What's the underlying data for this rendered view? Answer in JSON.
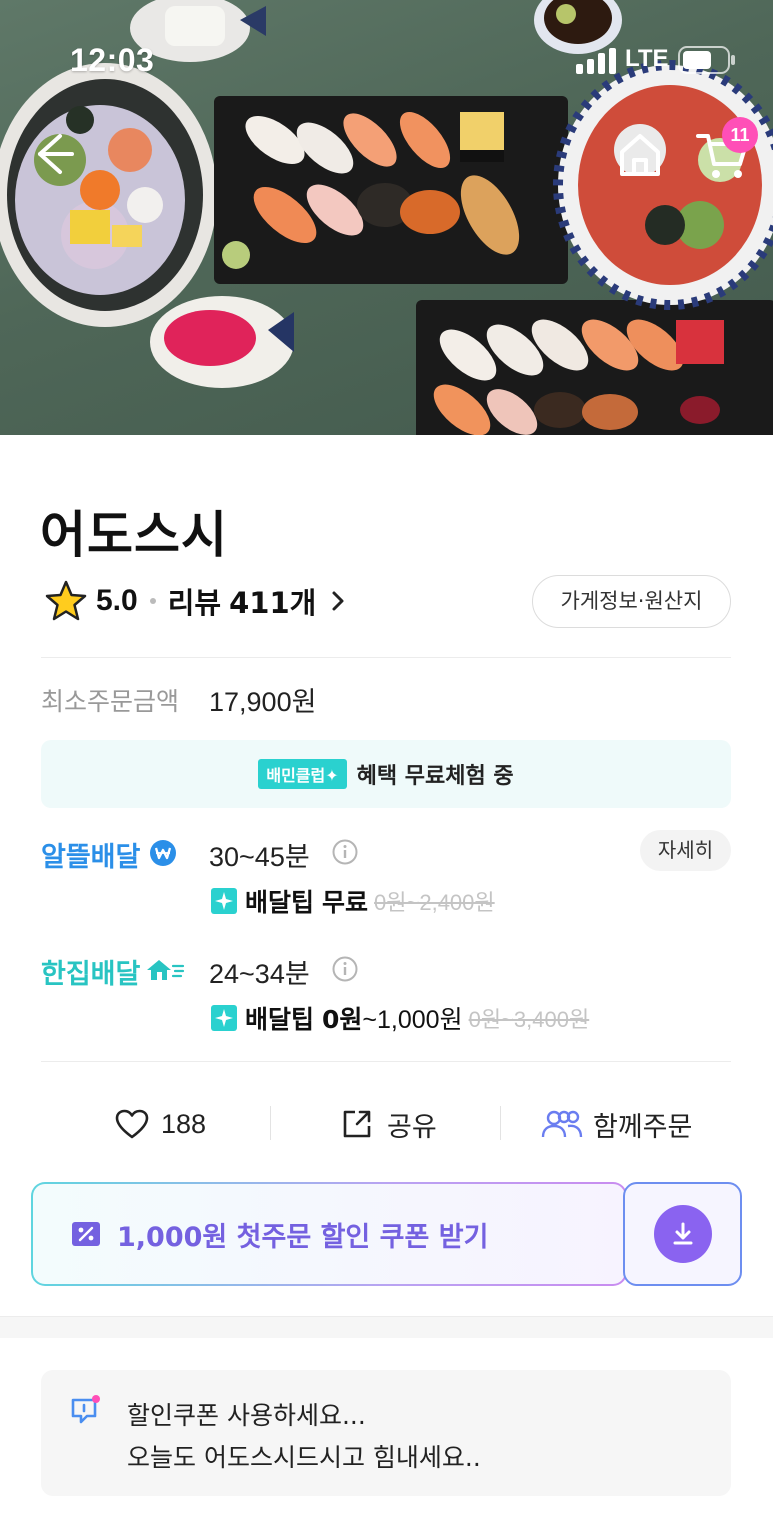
{
  "status_bar": {
    "time": "12:03",
    "network": "LTE"
  },
  "header": {
    "cart_count": "11"
  },
  "store": {
    "name": "어도스시",
    "rating": "5.0",
    "review_label": "리뷰",
    "review_count": "411개",
    "info_button": "가게정보·원산지"
  },
  "min_order": {
    "label": "최소주문금액",
    "value": "17,900원"
  },
  "club": {
    "tag": "배민클럽✦",
    "text": "혜택 무료체험 중"
  },
  "delivery_options": [
    {
      "name": "알뜰배달",
      "color": "#2b8fe8",
      "time": "30~45분",
      "tip_label": "배달팁",
      "tip_strong": "무료",
      "tip_extra": "",
      "tip_original": "0원~2,400원"
    },
    {
      "name": "한집배달",
      "color": "#28c4c2",
      "time": "24~34분",
      "tip_label": "배달팁",
      "tip_strong": "0원",
      "tip_extra": "~1,000원",
      "tip_original": "0원~3,400원"
    }
  ],
  "detail_button": "자세히",
  "actions": {
    "like_count": "188",
    "share_label": "공유",
    "group_order_label": "함께주문"
  },
  "coupon": {
    "text": "1,000원 첫주문 할인 쿠폰 받기"
  },
  "notice": {
    "line1": "할인쿠폰 사용하세요...",
    "line2": "오늘도 어도스시드시고 힘내세요.."
  }
}
